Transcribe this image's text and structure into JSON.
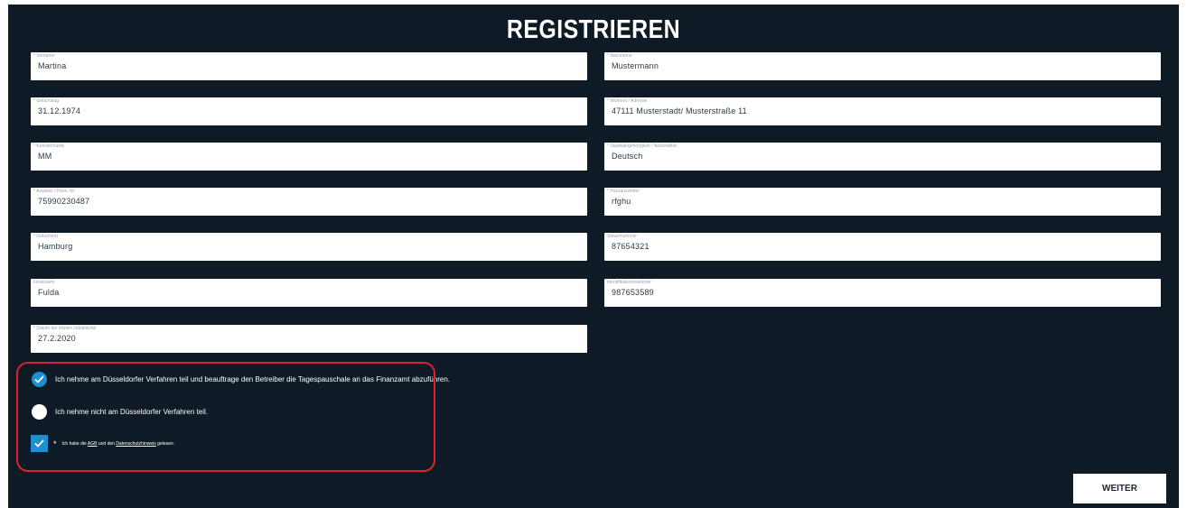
{
  "title": "REGISTRIEREN",
  "fields": {
    "vorname": {
      "label": "* Vorname",
      "value": "Martina"
    },
    "nachname": {
      "label": "* Nachname",
      "value": "Mustermann"
    },
    "geburtstag": {
      "label": "* Geburtstag",
      "value": "31.12.1974"
    },
    "wohnort": {
      "label": "* Wohnort / Adresse",
      "value": "47111 Musterstadt/ Musterstraße 11"
    },
    "kuenstlername": {
      "label": "* Künstlername",
      "value": "MM"
    },
    "staatsangehoerigkeit": {
      "label": "* Staatsangehörigkeit / Nationalität",
      "value": "Deutsch"
    },
    "ausweis": {
      "label": "* Ausweis / Pass- Nr.",
      "value": "75990230487"
    },
    "passaussteller": {
      "label": "* Passaussteller",
      "value": "rfghu"
    },
    "geburtsort": {
      "label": "* Geburtsort",
      "value": "Hamburg"
    },
    "steuernummer": {
      "label": "Steuernummer",
      "value": "87654321"
    },
    "finanzamt": {
      "label": "Finanzamt",
      "value": "Fulda"
    },
    "identifikationsnummer": {
      "label": "Identifikationsnummer",
      "value": "987653589"
    },
    "datum_jobaktivitaet": {
      "label": "* Datum der letzten Jobaktivität",
      "value": "27.2.2020"
    }
  },
  "options": {
    "teilnahme": {
      "text": "Ich nehme am Düsseldorfer Verfahren teil und beauftrage den Betreiber die Tagespauschale an das Finanzamt abzuführen.",
      "selected": true
    },
    "keine_teilnahme": {
      "text": "Ich nehme nicht am Düsseldorfer Verfahren teil.",
      "selected": false
    }
  },
  "consent": {
    "checked": true,
    "star": "*",
    "prefix": "Ich habe die",
    "agb_link": "AGB",
    "middle": "und den",
    "datenschutz_link": "Datenschutzhinweis",
    "suffix": "gelesen."
  },
  "buttons": {
    "weiter": "WEITER"
  },
  "colors": {
    "panel": "#0e1a26",
    "accent": "#1e8fd0",
    "highlight_border": "#d9232d"
  }
}
